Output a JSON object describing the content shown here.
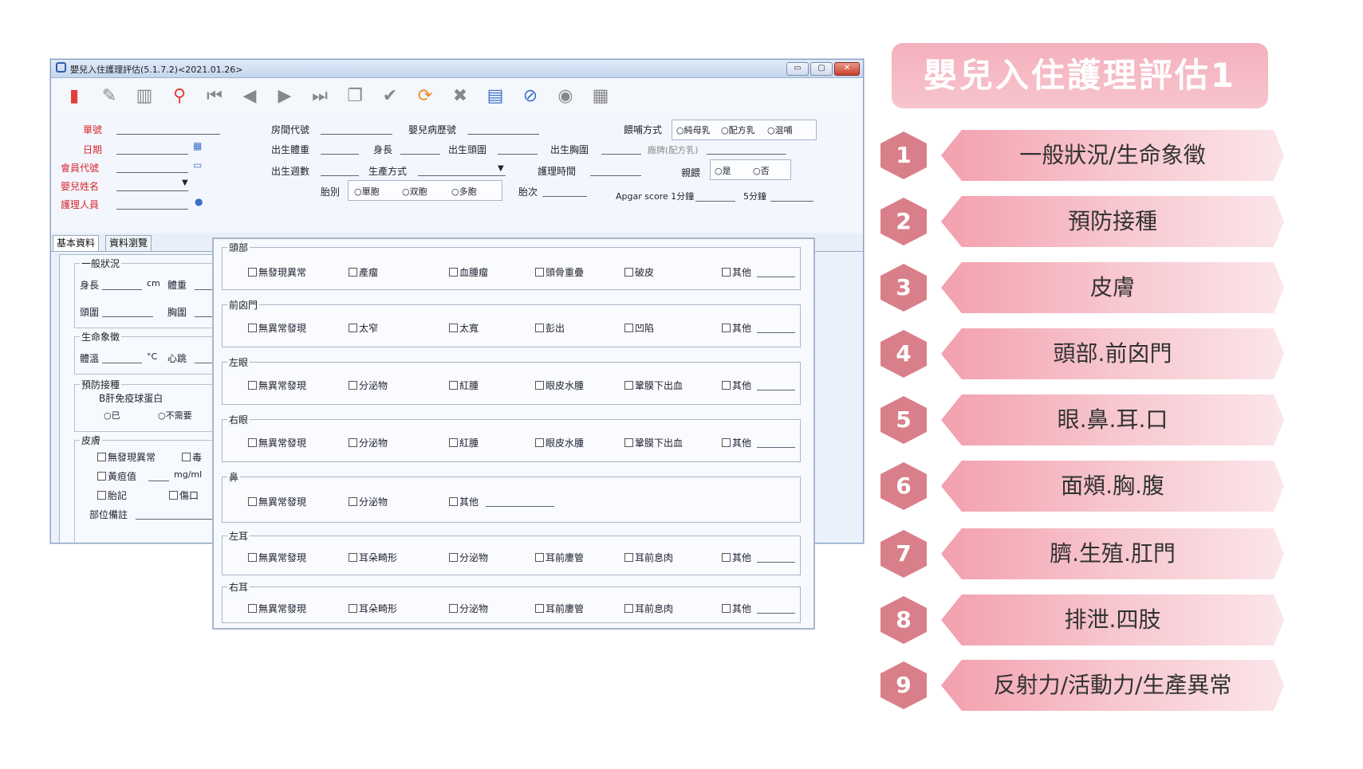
{
  "window": {
    "title": "嬰兒入住護理評估(5.1.7.2)<2021.01.26>",
    "controls": {
      "minimize": "▭",
      "maximize": "▢",
      "close": "✕"
    }
  },
  "toolbar": {
    "icons": [
      "add-icon",
      "edit-icon",
      "delete-icon",
      "search-icon",
      "first-icon",
      "prev-icon",
      "next-icon",
      "last-icon",
      "copy-icon",
      "confirm-icon",
      "refresh-icon",
      "cancel-icon",
      "book-icon",
      "attach-icon",
      "view-icon",
      "export-icon"
    ]
  },
  "header": {
    "fields": {
      "danhao": "單號",
      "date": "日期",
      "member_code": "會員代號",
      "baby_name": "嬰兒姓名",
      "nurse": "護理人員",
      "room_code": "房間代號",
      "baby_record": "嬰兒病歷號",
      "birth_weight": "出生體重",
      "length": "身長",
      "head_circ": "出生頭圍",
      "chest_circ": "出生胸圍",
      "birth_weeks": "出生週數",
      "delivery": "生產方式",
      "care_time": "護理時間",
      "feeding": "餵哺方式",
      "feed_opts": [
        "純母乳",
        "配方乳",
        "混哺"
      ],
      "brand_placeholder": "廠牌(配方乳)",
      "parity": "胎別",
      "parity_opts": [
        "單胞",
        "双胞",
        "多胞"
      ],
      "birth_order": "胎次",
      "rooming": "親餵",
      "rooming_opts": [
        "是",
        "否"
      ],
      "apgar1": "Apgar score 1分鐘",
      "apgar5": "5分鐘"
    }
  },
  "tabs": [
    "基本資料",
    "資料瀏覽"
  ],
  "left_panel": {
    "general": "一般狀況",
    "length": "身長",
    "cm": "cm",
    "weight": "體重",
    "head": "頭圍",
    "chest": "胸圍",
    "vitals": "生命象徵",
    "temp": "體溫",
    "celsius": "°C",
    "heart": "心跳",
    "vaccine": "預防接種",
    "hbig": "B肝免疫球蛋白",
    "hbig_opts": [
      "已",
      "不需要"
    ],
    "skin": "皮膚",
    "skin_opts": [
      "無發現異常",
      "毒",
      "黃疸值",
      "胎記",
      "傷口"
    ],
    "unit": "mg/ml",
    "note": "部位備註"
  },
  "sections": [
    {
      "title": "頭部",
      "options": [
        "無發現異常",
        "產瘤",
        "血腫瘤",
        "頭骨重疊",
        "破皮",
        "其他"
      ]
    },
    {
      "title": "前囟門",
      "options": [
        "無異常發現",
        "太窄",
        "太寬",
        "彭出",
        "凹陷",
        "其他"
      ]
    },
    {
      "title": "左眼",
      "options": [
        "無異常發現",
        "分泌物",
        "紅腫",
        "眼皮水腫",
        "鞏膜下出血",
        "其他"
      ]
    },
    {
      "title": "右眼",
      "options": [
        "無異常發現",
        "分泌物",
        "紅腫",
        "眼皮水腫",
        "鞏膜下出血",
        "其他"
      ]
    },
    {
      "title": "鼻",
      "options": [
        "無異常發現",
        "分泌物",
        "其他"
      ]
    },
    {
      "title": "左耳",
      "options": [
        "無異常發現",
        "耳朵畸形",
        "分泌物",
        "耳前廔管",
        "耳前息肉",
        "其他"
      ]
    },
    {
      "title": "右耳",
      "options": [
        "無異常發現",
        "耳朵畸形",
        "分泌物",
        "耳前廔管",
        "耳前息肉",
        "其他"
      ]
    }
  ],
  "right": {
    "title": "嬰兒入住護理評估1",
    "items": [
      {
        "num": "1",
        "label": "一般狀況/生命象徵"
      },
      {
        "num": "2",
        "label": "預防接種"
      },
      {
        "num": "3",
        "label": "皮膚"
      },
      {
        "num": "4",
        "label": "頭部.前囟門"
      },
      {
        "num": "5",
        "label": "眼.鼻.耳.口"
      },
      {
        "num": "6",
        "label": "面頰.胸.腹"
      },
      {
        "num": "7",
        "label": "臍.生殖.肛門"
      },
      {
        "num": "8",
        "label": "排泄.四肢"
      },
      {
        "num": "9",
        "label": "反射力/活動力/生產異常"
      }
    ]
  }
}
